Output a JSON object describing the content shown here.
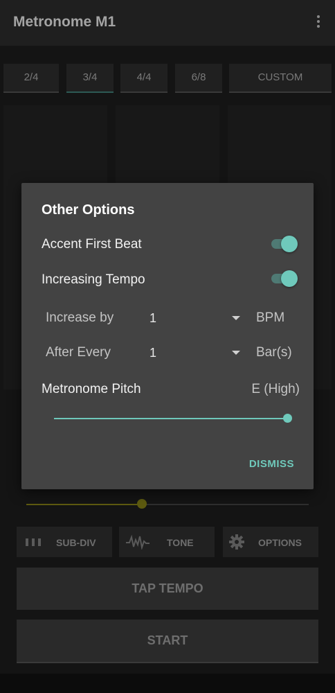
{
  "appbar": {
    "title": "Metronome M1",
    "menu_icon": "more-vert-icon"
  },
  "time_signatures": [
    "2/4",
    "3/4",
    "4/4",
    "6/8",
    "CUSTOM"
  ],
  "selected_time_signature": "3/4",
  "controls": {
    "subdiv_label": "SUB-DIV",
    "tone_label": "TONE",
    "options_label": "OPTIONS",
    "tap_tempo_label": "TAP TEMPO",
    "start_label": "START"
  },
  "tempo_slider": {
    "fraction": 0.41,
    "color": "#5d5a10"
  },
  "dialog": {
    "title": "Other Options",
    "accent_first_beat": {
      "label": "Accent First Beat",
      "on": true
    },
    "increasing_tempo": {
      "label": "Increasing Tempo",
      "on": true
    },
    "increase_by": {
      "label": "Increase by",
      "value": "1",
      "unit": "BPM"
    },
    "after_every": {
      "label": "After Every",
      "value": "1",
      "unit": "Bar(s)"
    },
    "pitch": {
      "label": "Metronome Pitch",
      "value": "E (High)",
      "fraction": 1.0
    },
    "dismiss_label": "DISMISS",
    "accent_color": "#6fc9bb"
  }
}
